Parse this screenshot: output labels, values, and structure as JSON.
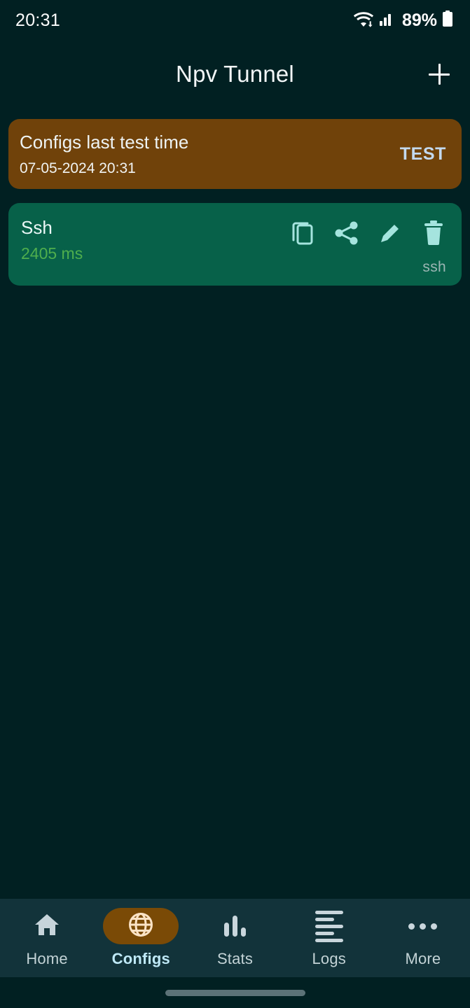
{
  "status_bar": {
    "time": "20:31",
    "battery_percent": "89%",
    "wifi_icon": "wifi-icon",
    "signal_icon": "cellular-signal-icon",
    "battery_icon": "battery-icon"
  },
  "app_bar": {
    "title": "Npv Tunnel",
    "add_button_icon": "plus-icon",
    "add_button_label": "+"
  },
  "test_card": {
    "title": "Configs last test time",
    "timestamp": "07-05-2024 20:31",
    "action_label": "TEST",
    "background_color": "#70420a",
    "action_color": "#c3d9ef"
  },
  "configs": [
    {
      "name": "Ssh",
      "latency": "2405 ms",
      "tag": "ssh",
      "background_color": "#076149",
      "latency_color": "#4fae4d",
      "actions": [
        {
          "name": "copy-icon",
          "label": "Copy"
        },
        {
          "name": "share-icon",
          "label": "Share"
        },
        {
          "name": "edit-icon",
          "label": "Edit"
        },
        {
          "name": "delete-icon",
          "label": "Delete"
        }
      ]
    }
  ],
  "bottom_nav": {
    "active": "Configs",
    "active_pill_color": "#7a4a06",
    "active_label_color": "#bfe9f7",
    "items": [
      {
        "label": "Home",
        "icon": "home-icon"
      },
      {
        "label": "Configs",
        "icon": "globe-icon"
      },
      {
        "label": "Stats",
        "icon": "bar-chart-icon"
      },
      {
        "label": "Logs",
        "icon": "list-lines-icon"
      },
      {
        "label": "More",
        "icon": "more-dots-icon"
      }
    ]
  },
  "theme": {
    "background": "#012022",
    "nav_background": "#12333a",
    "gesture_bar_color": "#5c7277"
  }
}
